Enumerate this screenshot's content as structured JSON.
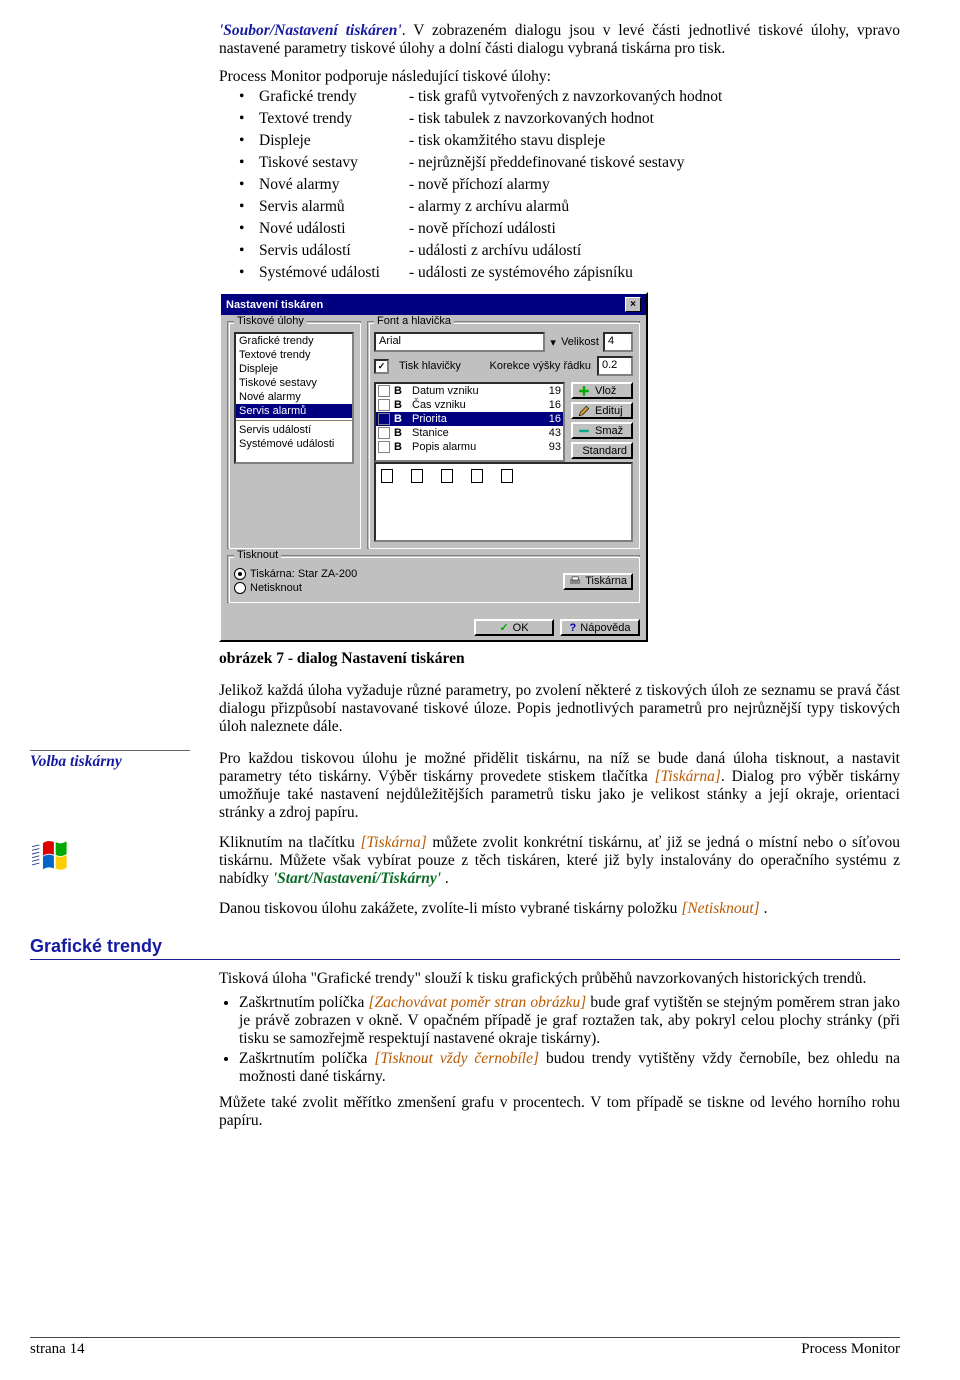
{
  "intro": {
    "menu_path": "'Soubor/Nastavení tiskáren'",
    "after_path": ". V zobrazeném dialogu jsou v levé části jednotlivé tiskové úlohy, vpravo nastavené parametry tiskové úlohy a dolní části dialogu vybraná tiskárna pro tisk.",
    "support_line": "Process Monitor podporuje následující tiskové úlohy:"
  },
  "jobs": [
    {
      "name": "Grafické trendy",
      "desc": "- tisk grafů vytvořených z navzorkovaných hodnot"
    },
    {
      "name": "Textové trendy",
      "desc": "- tisk tabulek z navzorkovaných hodnot"
    },
    {
      "name": "Displeje",
      "desc": "- tisk okamžitého stavu displeje"
    },
    {
      "name": "Tiskové sestavy",
      "desc": "- nejrůznější předdefinované tiskové sestavy"
    },
    {
      "name": "Nové alarmy",
      "desc": "- nově příchozí alarmy"
    },
    {
      "name": "Servis alarmů",
      "desc": "- alarmy z archívu alarmů"
    },
    {
      "name": "Nové události",
      "desc": "- nově příchozí události"
    },
    {
      "name": "Servis událostí",
      "desc": "- události z archívu událostí"
    },
    {
      "name": "Systémové události",
      "desc": "- události ze systémového zápisníku"
    }
  ],
  "dialog": {
    "title": "Nastavení tiskáren",
    "grp_jobs": "Tiskové úlohy",
    "grp_font": "Font a hlavička",
    "grp_print": "Tisknout",
    "font_name": "Arial",
    "size_label": "Velikost",
    "size_value": "4",
    "tisk_hlavicky": "Tisk hlavičky",
    "korekce_label": "Korekce výšky řádku",
    "korekce_value": "0.2",
    "header_items": [
      {
        "k": "B",
        "n": "Datum vzniku",
        "v": "19"
      },
      {
        "k": "B",
        "n": "Čas vzniku",
        "v": "16"
      },
      {
        "k": "B",
        "n": "Priorita",
        "v": "16",
        "sel": true
      },
      {
        "k": "B",
        "n": "Stanice",
        "v": "43"
      },
      {
        "k": "B",
        "n": "Popis alarmu",
        "v": "93"
      }
    ],
    "list_items": [
      "Grafické trendy",
      "Textové trendy",
      "Displeje",
      "Tiskové sestavy",
      "Nové alarmy",
      "Servis alarmů",
      "---",
      "Servis událostí",
      "Systémové události"
    ],
    "list_selected": 5,
    "btn_vloz": "Vlož",
    "btn_edit": "Edituj",
    "btn_smaz": "Smaž",
    "btn_standard": "Standard",
    "radio_printer": "Tiskárna: Star ZA-200",
    "radio_noprint": "Netisknout",
    "btn_tiskarna": "Tiskárna",
    "btn_ok": "OK",
    "btn_help": "Nápověda"
  },
  "caption": "obrázek 7 - dialog Nastavení tiskáren",
  "after_img": "Jelikož každá úloha vyžaduje různé parametry, po zvolení některé z tiskových úloh ze seznamu se pravá část dialogu přizpůsobí nastavované tiskové úloze. Popis jednotlivých parametrů pro nejrůznější typy tiskových úloh naleznete dále.",
  "margin_volba": "Volba tiskárny",
  "volba_p1_a": "Pro každou tiskovou úlohu je možné přidělit tiskárnu, na níž se bude daná úloha tisknout, a nastavit parametry této tiskárny. Výběr tiskárny provedete stiskem tlačítka ",
  "volba_p1_btn": "[Tiskárna]",
  "volba_p1_b": ". Dialog pro výběr tiskárny umožňuje také nastavení nejdůležitějších parametrů tisku jako je velikost stánky a její okraje, orientaci stránky a zdroj papíru.",
  "volba_p2_a": "Kliknutím na tlačítku ",
  "volba_p2_btn": "[Tiskárna]",
  "volba_p2_b": " můžete zvolit konkrétní tiskárnu, ať již se jedná o místní nebo o síťovou tiskárnu. Můžete však vybírat pouze z těch tiskáren, které již byly instalovány do operačního systému z nabídky ",
  "volba_p2_menu": "'Start/Nastavení/Tiskárny'",
  "volba_p2_c": " .",
  "volba_p3_a": "Danou tiskovou úlohu zakážete, zvolíte-li místo vybrané tiskárny položku ",
  "volba_p3_btn": "[Netisknout]",
  "volba_p3_b": " .",
  "section_title": "Grafické trendy",
  "gt_intro": "Tisková úloha \"Grafické trendy\" slouží k tisku grafických průběhů navzorkovaných historických trendů.",
  "gt_b1_a": "Zaškrtnutím políčka ",
  "gt_b1_opt": "[Zachovávat poměr stran obrázku]",
  "gt_b1_b": " bude graf vytištěn se stejným poměrem stran jako je právě zobrazen v okně. V opačném případě je graf roztažen tak, aby pokryl celou plochy stránky (při tisku se samozřejmě respektují nastavené okraje tiskárny).",
  "gt_b2_a": "Zaškrtnutím políčka ",
  "gt_b2_opt": "[Tisknout vždy černobíle]",
  "gt_b2_b": " budou trendy vytištěny vždy černobíle, bez ohledu na možnosti dané tiskárny.",
  "gt_outro": "Můžete také zvolit měřítko zmenšení grafu v procentech. V tom případě se tiskne od levého horního rohu papíru.",
  "footer_left": "strana 14",
  "footer_right": "Process Monitor"
}
